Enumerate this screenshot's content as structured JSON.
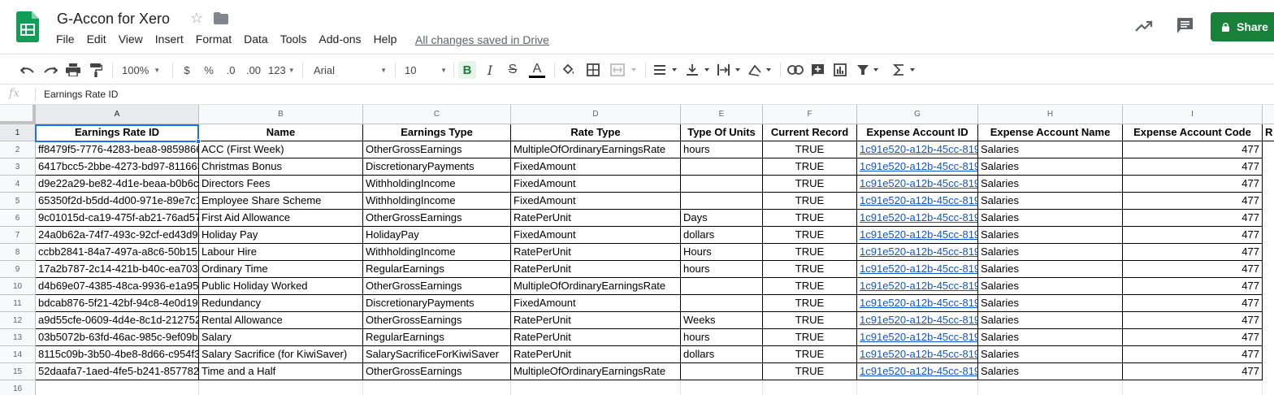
{
  "app": {
    "title": "G-Accon for Xero",
    "saved_status": "All changes saved in Drive",
    "share_label": "Share",
    "menu": [
      "File",
      "Edit",
      "View",
      "Insert",
      "Format",
      "Data",
      "Tools",
      "Add-ons",
      "Help"
    ]
  },
  "toolbar": {
    "zoom": "100%",
    "currency": "$",
    "percent": "%",
    "decrease_decimal": ".0",
    "increase_decimal": ".00",
    "more_formats": "123",
    "font": "Arial",
    "font_size": "10",
    "bold": "B",
    "italic": "I",
    "strike": "S",
    "text_color": "A"
  },
  "formula_bar": {
    "fx": "fx",
    "value": "Earnings Rate ID"
  },
  "sheet": {
    "columns": [
      "A",
      "B",
      "C",
      "D",
      "E",
      "F",
      "G",
      "H",
      "I"
    ],
    "row_numbers": [
      "1",
      "2",
      "3",
      "4",
      "5",
      "6",
      "7",
      "8",
      "9",
      "10",
      "11",
      "12",
      "13",
      "14",
      "15",
      "16"
    ],
    "headers": [
      "Earnings Rate ID",
      "Name",
      "Earnings Type",
      "Rate Type",
      "Type Of Units",
      "Current Record",
      "Expense Account ID",
      "Expense Account Name",
      "Expense Account Code",
      "R"
    ],
    "rows": [
      {
        "a": "ff8479f5-7776-4283-bea8-9859866",
        "b": "ACC (First Week)",
        "c": "OtherGrossEarnings",
        "d": "MultipleOfOrdinaryEarningsRate",
        "e": "hours",
        "f": "TRUE",
        "g": "1c91e520-a12b-45cc-819",
        "h": "Salaries",
        "i": "477"
      },
      {
        "a": "6417bcc5-2bbe-4273-bd97-811663",
        "b": "Christmas Bonus",
        "c": "DiscretionaryPayments",
        "d": "FixedAmount",
        "e": "",
        "f": "TRUE",
        "g": "1c91e520-a12b-45cc-819",
        "h": "Salaries",
        "i": "477"
      },
      {
        "a": "d9e22a29-be82-4d1e-beaa-b0b6c",
        "b": "Directors Fees",
        "c": "WithholdingIncome",
        "d": "FixedAmount",
        "e": "",
        "f": "TRUE",
        "g": "1c91e520-a12b-45cc-819",
        "h": "Salaries",
        "i": "477"
      },
      {
        "a": "65350f2d-b5dd-4d00-971e-89e7c1",
        "b": "Employee Share Scheme",
        "c": "WithholdingIncome",
        "d": "FixedAmount",
        "e": "",
        "f": "TRUE",
        "g": "1c91e520-a12b-45cc-819",
        "h": "Salaries",
        "i": "477"
      },
      {
        "a": "9c01015d-ca19-475f-ab21-76ad57",
        "b": "First Aid Allowance",
        "c": "OtherGrossEarnings",
        "d": "RatePerUnit",
        "e": "Days",
        "f": "TRUE",
        "g": "1c91e520-a12b-45cc-819",
        "h": "Salaries",
        "i": "477"
      },
      {
        "a": "24a0b62a-74f7-493c-92cf-ed43d9",
        "b": "Holiday Pay",
        "c": "HolidayPay",
        "d": "FixedAmount",
        "e": "dollars",
        "f": "TRUE",
        "g": "1c91e520-a12b-45cc-819",
        "h": "Salaries",
        "i": "477"
      },
      {
        "a": "ccbb2841-84a7-497a-a8c6-50b15",
        "b": "Labour Hire",
        "c": "WithholdingIncome",
        "d": "RatePerUnit",
        "e": "Hours",
        "f": "TRUE",
        "g": "1c91e520-a12b-45cc-819",
        "h": "Salaries",
        "i": "477"
      },
      {
        "a": "17a2b787-2c14-421b-b40c-ea703",
        "b": "Ordinary Time",
        "c": "RegularEarnings",
        "d": "RatePerUnit",
        "e": "hours",
        "f": "TRUE",
        "g": "1c91e520-a12b-45cc-819",
        "h": "Salaries",
        "i": "477"
      },
      {
        "a": "d4b69e07-4385-48ca-9936-e1a95",
        "b": "Public Holiday Worked",
        "c": "OtherGrossEarnings",
        "d": "MultipleOfOrdinaryEarningsRate",
        "e": "",
        "f": "TRUE",
        "g": "1c91e520-a12b-45cc-819",
        "h": "Salaries",
        "i": "477"
      },
      {
        "a": "bdcab876-5f21-42bf-94c8-4e0d19",
        "b": "Redundancy",
        "c": "DiscretionaryPayments",
        "d": "FixedAmount",
        "e": "",
        "f": "TRUE",
        "g": "1c91e520-a12b-45cc-819",
        "h": "Salaries",
        "i": "477"
      },
      {
        "a": "a9d55cfe-0609-4d4e-8c1d-212752",
        "b": "Rental Allowance",
        "c": "OtherGrossEarnings",
        "d": "RatePerUnit",
        "e": "Weeks",
        "f": "TRUE",
        "g": "1c91e520-a12b-45cc-819",
        "h": "Salaries",
        "i": "477"
      },
      {
        "a": "03b5072b-63fd-46ac-985c-9ef09b",
        "b": "Salary",
        "c": "RegularEarnings",
        "d": "RatePerUnit",
        "e": "hours",
        "f": "TRUE",
        "g": "1c91e520-a12b-45cc-819",
        "h": "Salaries",
        "i": "477"
      },
      {
        "a": "8115c09b-3b50-4be8-8d66-c954f3",
        "b": "Salary Sacrifice (for KiwiSaver)",
        "c": "SalarySacrificeForKiwiSaver",
        "d": "RatePerUnit",
        "e": "dollars",
        "f": "TRUE",
        "g": "1c91e520-a12b-45cc-819",
        "h": "Salaries",
        "i": "477"
      },
      {
        "a": "52daafa7-1aed-4fe5-b241-857782",
        "b": "Time and a Half",
        "c": "OtherGrossEarnings",
        "d": "MultipleOfOrdinaryEarningsRate",
        "e": "",
        "f": "TRUE",
        "g": "1c91e520-a12b-45cc-819",
        "h": "Salaries",
        "i": "477"
      }
    ]
  },
  "colors": {
    "accent": "#188038",
    "selection": "#1a73e8",
    "link": "#1155cc"
  }
}
